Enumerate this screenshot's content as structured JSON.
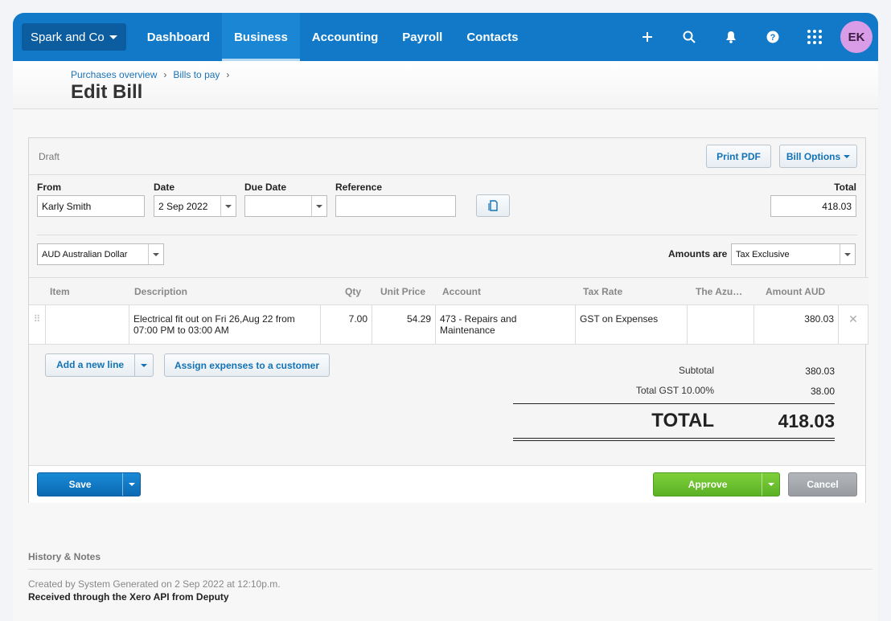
{
  "nav": {
    "org_name": "Spark and Co",
    "links": [
      "Dashboard",
      "Business",
      "Accounting",
      "Payroll",
      "Contacts"
    ],
    "active": "Business",
    "avatar_initials": "EK",
    "icons": [
      "plus-icon",
      "search-icon",
      "bell-icon",
      "help-icon",
      "apps-grid-icon"
    ]
  },
  "breadcrumb": {
    "items": [
      "Purchases overview",
      "Bills to pay"
    ],
    "separator": "›"
  },
  "page_title": "Edit Bill",
  "bill": {
    "status": "Draft",
    "print_pdf_label": "Print PDF",
    "bill_options_label": "Bill Options",
    "labels": {
      "from": "From",
      "date": "Date",
      "due_date": "Due Date",
      "reference": "Reference",
      "total": "Total",
      "amounts_are": "Amounts are"
    },
    "from_value": "Karly Smith",
    "date_value": "2 Sep 2022",
    "due_date_value": "",
    "reference_value": "",
    "total_value": "418.03",
    "currency_value": "AUD Australian Dollar",
    "amounts_are_value": "Tax Exclusive"
  },
  "table": {
    "columns": [
      "Item",
      "Description",
      "Qty",
      "Unit Price",
      "Account",
      "Tax Rate",
      "The Azu…",
      "Amount AUD"
    ],
    "rows": [
      {
        "item": "",
        "description": "Electrical fit out on Fri 26,Aug 22 from 07:00 PM to 03:00 AM",
        "qty": "7.00",
        "unit_price": "54.29",
        "account": "473 - Repairs and Maintenance",
        "tax_rate": "GST on Expenses",
        "tracking": "",
        "amount": "380.03"
      }
    ],
    "delete_glyph": "✕",
    "drag_glyph": "⠿"
  },
  "actions": {
    "add_line_label": "Add a new line",
    "assign_label": "Assign expenses to a customer"
  },
  "totals": {
    "subtotal_label": "Subtotal",
    "subtotal_value": "380.03",
    "gst_label": "Total GST 10.00%",
    "gst_value": "38.00",
    "total_label": "TOTAL",
    "total_value": "418.03"
  },
  "footer": {
    "save_label": "Save",
    "approve_label": "Approve",
    "cancel_label": "Cancel"
  },
  "history": {
    "title": "History & Notes",
    "line1": "Created by System Generated on 2 Sep 2022 at 12:10p.m.",
    "line2": "Received through the Xero API from Deputy"
  },
  "colors": {
    "nav_blue": "#1179c7",
    "save_blue": "#0f78c6",
    "approve_green": "#6ac12c",
    "cancel_grey": "#a0a4a8",
    "link_blue": "#1273b6"
  }
}
